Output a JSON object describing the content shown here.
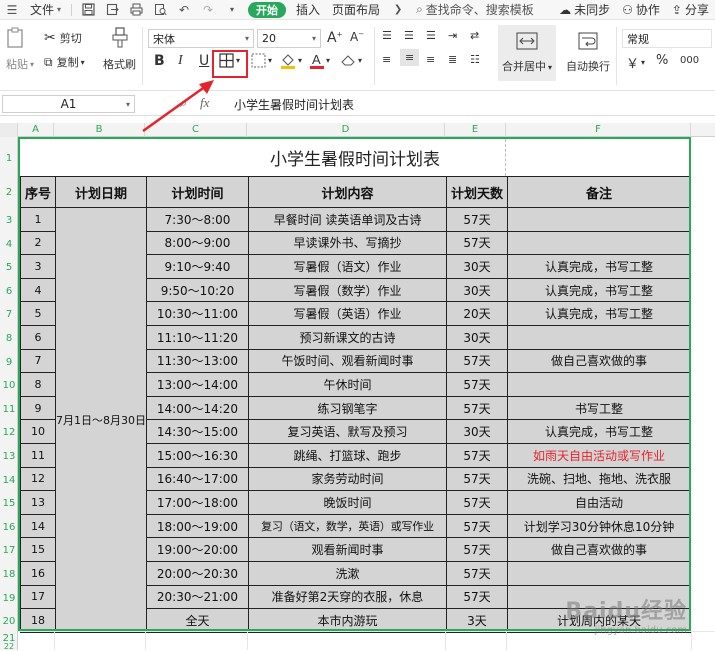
{
  "menubar": {
    "file": "文件",
    "tab_start": "开始",
    "tab_insert": "插入",
    "tab_layout": "页面布局",
    "search": "查找命令、搜索模板",
    "unsync": "未同步",
    "collab": "协作",
    "share": "分享"
  },
  "ribbon": {
    "paste": "粘贴",
    "cut": "剪切",
    "copy": "复制",
    "format_painter": "格式刷",
    "font_name": "宋体",
    "font_size": "20",
    "bold": "B",
    "italic": "I",
    "underline": "U",
    "merge_center": "合并居中",
    "wrap_text": "自动换行",
    "number_format": "常规",
    "currency": "￥",
    "percent": "%",
    "thousands": "000"
  },
  "formula_bar": {
    "cell_ref": "A1",
    "fx": "fx",
    "content": "小学生暑假时间计划表"
  },
  "columns": [
    "A",
    "B",
    "C",
    "D",
    "E",
    "F"
  ],
  "rows": [
    "1",
    "2",
    "3",
    "4",
    "5",
    "6",
    "7",
    "8",
    "9",
    "10",
    "11",
    "12",
    "13",
    "14",
    "15",
    "16",
    "17",
    "18",
    "19",
    "20",
    "21",
    "22"
  ],
  "sheet": {
    "title": "小学生暑假时间计划表",
    "headers": [
      "序号",
      "计划日期",
      "计划时间",
      "计划内容",
      "计划天数",
      "备注"
    ],
    "date_range": "7月1日～8月30日",
    "entries": [
      {
        "seq": "1",
        "time": "7:30～8:00",
        "content": "早餐时间 读英语单词及古诗",
        "days": "57天",
        "note": ""
      },
      {
        "seq": "2",
        "time": "8:00～9:00",
        "content": "早读课外书、写摘抄",
        "days": "57天",
        "note": ""
      },
      {
        "seq": "3",
        "time": "9:10～9:40",
        "content": "写暑假（语文）作业",
        "days": "30天",
        "note": "认真完成，书写工整"
      },
      {
        "seq": "4",
        "time": "9:50～10:20",
        "content": "写暑假（数学）作业",
        "days": "30天",
        "note": "认真完成，书写工整"
      },
      {
        "seq": "5",
        "time": "10:30～11:00",
        "content": "写暑假（英语）作业",
        "days": "20天",
        "note": "认真完成，书写工整"
      },
      {
        "seq": "6",
        "time": "11:10～11:20",
        "content": "预习新课文的古诗",
        "days": "30天",
        "note": ""
      },
      {
        "seq": "7",
        "time": "11:30～13:00",
        "content": "午饭时间、观看新闻时事",
        "days": "57天",
        "note": "做自己喜欢做的事"
      },
      {
        "seq": "8",
        "time": "13:00～14:00",
        "content": "午休时间",
        "days": "57天",
        "note": ""
      },
      {
        "seq": "9",
        "time": "14:00～14:20",
        "content": "练习钢笔字",
        "days": "57天",
        "note": "书写工整"
      },
      {
        "seq": "10",
        "time": "14:30～15:00",
        "content": "复习英语、默写及预习",
        "days": "30天",
        "note": "认真完成，书写工整"
      },
      {
        "seq": "11",
        "time": "15:00～16:30",
        "content": "跳绳、打篮球、跑步",
        "days": "57天",
        "note": "如雨天自由活动或写作业"
      },
      {
        "seq": "12",
        "time": "16:40～17:00",
        "content": "家务劳动时间",
        "days": "57天",
        "note": "洗碗、扫地、拖地、洗衣服"
      },
      {
        "seq": "13",
        "time": "17:00～18:00",
        "content": "晚饭时间",
        "days": "57天",
        "note": "自由活动"
      },
      {
        "seq": "14",
        "time": "18:00～19:00",
        "content": "复习（语文，数学，英语）或写作业",
        "days": "57天",
        "note": "计划学习30分钟休息10分钟"
      },
      {
        "seq": "15",
        "time": "19:00～20:00",
        "content": "观看新闻时事",
        "days": "57天",
        "note": "做自己喜欢做的事"
      },
      {
        "seq": "16",
        "time": "20:00～20:30",
        "content": "洗漱",
        "days": "57天",
        "note": ""
      },
      {
        "seq": "17",
        "time": "20:30～21:00",
        "content": "准备好第2天穿的衣服，休息",
        "days": "57天",
        "note": ""
      },
      {
        "seq": "18",
        "time": "全天",
        "content": "本市内游玩",
        "days": "3天",
        "note": "计划周内的某天"
      }
    ],
    "red_note_color": "#e3242b"
  },
  "accent_color": "#27a85a",
  "watermark": {
    "brand": "Baidu经验",
    "url": "jingyan.baidu.com"
  }
}
